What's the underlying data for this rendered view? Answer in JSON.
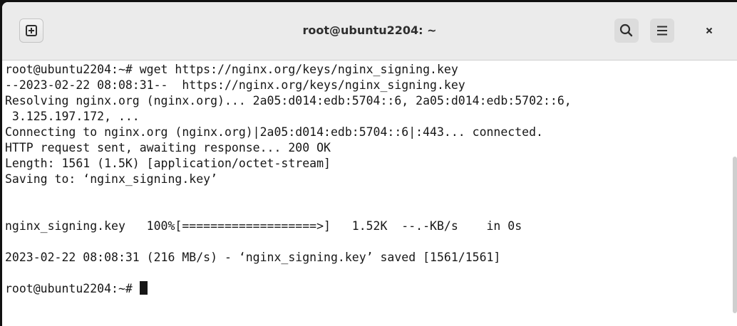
{
  "window": {
    "title": "root@ubuntu2204: ~"
  },
  "toolbar": {
    "new_tab_icon": "plus-square-icon",
    "search_icon": "search-icon",
    "menu_icon": "hamburger-menu-icon",
    "close_icon": "close-icon"
  },
  "terminal": {
    "lines": [
      "root@ubuntu2204:~# wget https://nginx.org/keys/nginx_signing.key",
      "--2023-02-22 08:08:31--  https://nginx.org/keys/nginx_signing.key",
      "Resolving nginx.org (nginx.org)... 2a05:d014:edb:5704::6, 2a05:d014:edb:5702::6,",
      " 3.125.197.172, ...",
      "Connecting to nginx.org (nginx.org)|2a05:d014:edb:5704::6|:443... connected.",
      "HTTP request sent, awaiting response... 200 OK",
      "Length: 1561 (1.5K) [application/octet-stream]",
      "Saving to: ‘nginx_signing.key’",
      "",
      "nginx_signing.key   100%[===================>]   1.52K  --.-KB/s    in 0s",
      "",
      "2023-02-22 08:08:31 (216 MB/s) - ‘nginx_signing.key’ saved [1561/1561]",
      "",
      "root@ubuntu2204:~# "
    ]
  },
  "colors": {
    "titlebar_bg": "#ebebeb",
    "terminal_bg": "#ffffff",
    "text": "#171717"
  }
}
